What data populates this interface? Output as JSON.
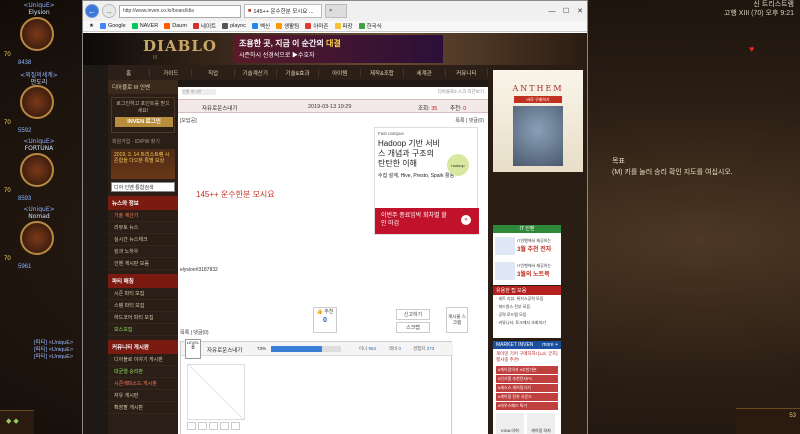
{
  "game": {
    "party": [
      {
        "name": "<UniquE>",
        "sub": "Elysion",
        "level": "70",
        "num": "8438"
      },
      {
        "name": "<외질의세계>",
        "sub": "만도리",
        "level": "70",
        "num": "5592"
      },
      {
        "name": "<UniquE>",
        "sub": "FORTUNA",
        "level": "70",
        "num": "8593"
      },
      {
        "name": "<UniquE>",
        "sub": "Nomad",
        "level": "70",
        "num": "5961"
      }
    ],
    "chat_lines": [
      "[파티] <UniquE>",
      "[파티] <UniquE>",
      "[파티] <UniquE>"
    ],
    "zone_title": "신 트리스트램",
    "zone_sub": "고행 XIII (70) 오후 9:21",
    "objective_title": "목표",
    "objective_text": "(M) 키를 눌러 승리 확인 지도를 여십시오.",
    "corner_left": "◆ ◆",
    "corner_right": "53"
  },
  "browser": {
    "url": "http://www.inven.co.kr/board/dia",
    "tabs": [
      {
        "label": "145++ 운수한분 모시요 ..."
      },
      {
        "label": "×"
      }
    ],
    "window_controls": [
      "—",
      "☐",
      "✕"
    ],
    "favorites": [
      {
        "label": "Google",
        "color": "#4285f4"
      },
      {
        "label": "NAVER",
        "color": "#03c75a"
      },
      {
        "label": "Daum",
        "color": "#ff5a00"
      },
      {
        "label": "네이트",
        "color": "#d32f2f"
      },
      {
        "label": "plaync",
        "color": "#555555"
      },
      {
        "label": "백신",
        "color": "#1e88e5"
      },
      {
        "label": "생활팀",
        "color": "#ff9800"
      },
      {
        "label": "아마존",
        "color": "#e53935"
      },
      {
        "label": "파장",
        "color": "#fbc02d"
      },
      {
        "label": "한국식",
        "color": "#43a047"
      }
    ]
  },
  "site": {
    "logo": "DIABLO",
    "logo_sub": "III",
    "ad_top_line1": "조용한 곳, 지금 이 순간의",
    "ad_top_em": "대결",
    "ad_top_line2": "시즌하시 선경석으로 ▶수호자",
    "nav": [
      "홈",
      "가이드",
      "직업",
      "기술계산기",
      "기술&효과",
      "아이템",
      "제작&조합",
      "세계관",
      "커뮤니티"
    ]
  },
  "left": {
    "header": "디아블로 III 인벤",
    "login_text": "로그인하고 포인트를 받으세요!",
    "login_button": "INVEN 로그인",
    "small_links": "회원가입 · ID/PW 찾기",
    "event_text": "2019. 3. 14 트리스트램 시즌합을 다으본 특별 보상",
    "search_placeholder": "디아 인벤 통합검색",
    "sections": [
      {
        "title": "뉴스와 정보",
        "items": [
          {
            "label": "기술 계산기",
            "tone": "red"
          },
          {
            "label": "리뷰토 뉴스",
            "tone": ""
          },
          {
            "label": "실시간 뉴스체크",
            "tone": ""
          },
          {
            "label": "킹과 노하우",
            "tone": ""
          },
          {
            "label": "인벤 게시판 모음",
            "tone": ""
          }
        ]
      },
      {
        "title": "파티 매칭",
        "items": [
          {
            "label": "시즌 파티 모집",
            "tone": ""
          },
          {
            "label": "스템 파티 모집",
            "tone": ""
          },
          {
            "label": "하드코어 파티 모집",
            "tone": ""
          },
          {
            "label": "보스모집",
            "tone": "grn"
          }
        ]
      },
      {
        "title": "커뮤니티 게시판",
        "items": [
          {
            "label": "디아블로 이야기 게시판",
            "tone": ""
          },
          {
            "label": "대균열 승리판",
            "tone": "grn"
          },
          {
            "label": "시즌에피소드 게시판",
            "tone": "red"
          },
          {
            "label": "자유 게시판",
            "tone": ""
          },
          {
            "label": "확장팔 게시판",
            "tone": ""
          }
        ]
      }
    ]
  },
  "article": {
    "breadcrumb": "인벤 게시판",
    "top_right": "디아블로3 스크 리단보기",
    "author": "자유로운스내기",
    "date": "2019-03-13 19:29",
    "views_label": "조회:",
    "views": "35",
    "rec_label": "추천:",
    "rec": "0",
    "category": "[오답공]",
    "list_link": "목록 | 댓글(0)",
    "title": "145++ 운수한분 모시요",
    "signature": "elysion#3187832",
    "rec_button_label": "추천",
    "rec_button_count": "0",
    "report_button": "신고하기",
    "scrap_button": "스크랩",
    "share_button": "게시물 스크랩",
    "comment_count": "목록 | 댓글(0)",
    "profile": {
      "level_label": "LEVEL",
      "level": "8",
      "name": "자유로운스내기",
      "exp_pct": "73%",
      "exp_fill": 0.73,
      "stat1_label": "이니",
      "stat1": "953",
      "stat2_label": "레비",
      "stat2": "0",
      "stat3_label": "경험치",
      "stat3": "273"
    }
  },
  "ad_right_article": {
    "brand": "Fast campus",
    "heading": "Hadoop 기반 서비스 개념과 구조의 탄탄한 이해",
    "logo": "hadoop",
    "tech": "수집 설계, Hive, Presto, Spark 활용",
    "cta": "이번주 종료임박 회차별 할인 마감",
    "cta_icon": "»"
  },
  "rside": {
    "anthem_title": "ANTHEM",
    "anthem_sub": "바로 구매하기",
    "it_header": "IT 인벤",
    "it_rows": [
      {
        "text": "IT인벤에서 제공하는",
        "em": "3월 추천 전자"
      },
      {
        "text": "IT인벤에서 제공하는",
        "em": "3월의 노트북"
      }
    ],
    "useful_header": "유용한 팁 모음",
    "useful_items": [
      "· 세트 리뷰: 위치스공략 모음",
      "· 파드원스 전부 모음",
      "· 공략 로드맵 모음",
      "· 커뮤니티: 토크에서 조회하기"
    ],
    "market_header": "MARKET INVEN",
    "market_more": "more +",
    "market_sub": "게이밍 기어 구매하자! [Lol, 굿즈] 행사중 추천!",
    "market_tags": [
      "#게이밍의자 #추천기본",
      "#인기홈 추천전자PC",
      "#세스스 게이밍기기",
      "#게이밍 전자 사운드",
      "#마우스패드 특가"
    ],
    "products": [
      "K/DA 이허",
      "게이밍 의자"
    ]
  }
}
